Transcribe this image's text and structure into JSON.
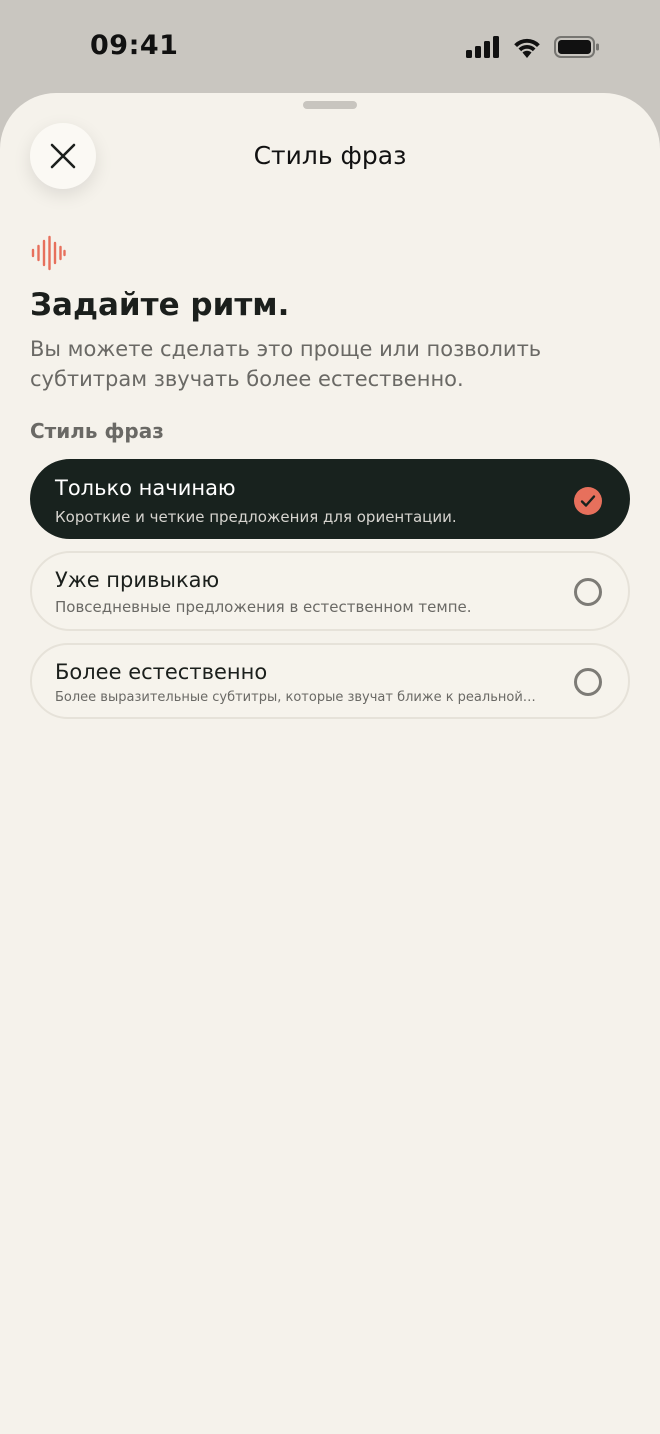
{
  "status_bar": {
    "time": "09:41"
  },
  "sheet": {
    "title": "Стиль фраз"
  },
  "content": {
    "heading": "Задайте ритм.",
    "description": "Вы можете сделать это проще или позволить субтитрам звучать более естественно.",
    "section_label": "Стиль фраз"
  },
  "options": [
    {
      "title": "Только начинаю",
      "subtitle": "Короткие и четкие предложения для ориентации.",
      "selected": true
    },
    {
      "title": "Уже привыкаю",
      "subtitle": "Повседневные предложения в естественном темпе.",
      "selected": false
    },
    {
      "title": "Более естественно",
      "subtitle": "Более выразительные субтитры, которые звучат ближе к реальной…",
      "selected": false
    }
  ],
  "icons": {
    "close": "close-icon",
    "wave": "sound-wave-icon",
    "check": "checkmark-icon",
    "signal": "cellular-signal-icon",
    "wifi": "wifi-icon",
    "battery": "battery-icon"
  },
  "colors": {
    "sheet_background": "#f5f2eb",
    "outer_background": "#c9c6c0",
    "selected_option": "#18221e",
    "accent": "#e7705c",
    "text_primary": "#1b1f1c",
    "text_secondary": "#6a6965"
  }
}
